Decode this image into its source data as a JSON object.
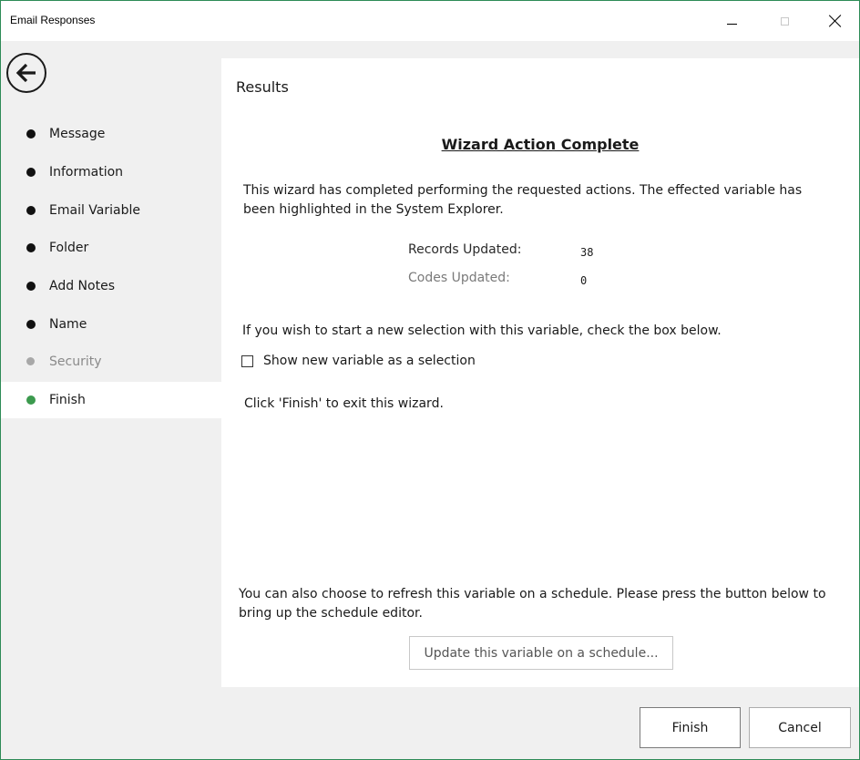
{
  "window": {
    "title": "Email Responses"
  },
  "nav": {
    "items": [
      {
        "label": "Message",
        "state": "done"
      },
      {
        "label": "Information",
        "state": "done"
      },
      {
        "label": "Email Variable",
        "state": "done"
      },
      {
        "label": "Folder",
        "state": "done"
      },
      {
        "label": "Add Notes",
        "state": "done"
      },
      {
        "label": "Name",
        "state": "done"
      },
      {
        "label": "Security",
        "state": "disabled"
      },
      {
        "label": "Finish",
        "state": "active"
      }
    ]
  },
  "content": {
    "section_title": "Results",
    "heading": "Wizard Action Complete",
    "intro_text": "This wizard has completed performing the requested actions. The effected variable has been highlighted in the System Explorer.",
    "stats": {
      "records_label": "Records Updated:",
      "records_value": "38",
      "codes_label": "Codes Updated:",
      "codes_value": "0"
    },
    "selection_text": "If you wish to start a new selection with this variable, check the box below.",
    "checkbox_label": "Show new variable as a selection",
    "checkbox_checked": false,
    "finish_hint": "Click 'Finish' to exit this wizard.",
    "schedule_text": "You can also choose to refresh this variable on a schedule.  Please press the button below to bring up the schedule editor.",
    "schedule_button": "Update this variable on a schedule..."
  },
  "footer": {
    "finish_label": "Finish",
    "cancel_label": "Cancel"
  },
  "colors": {
    "active_dot": "#3c9a4e",
    "window_border": "#2e8b57"
  }
}
